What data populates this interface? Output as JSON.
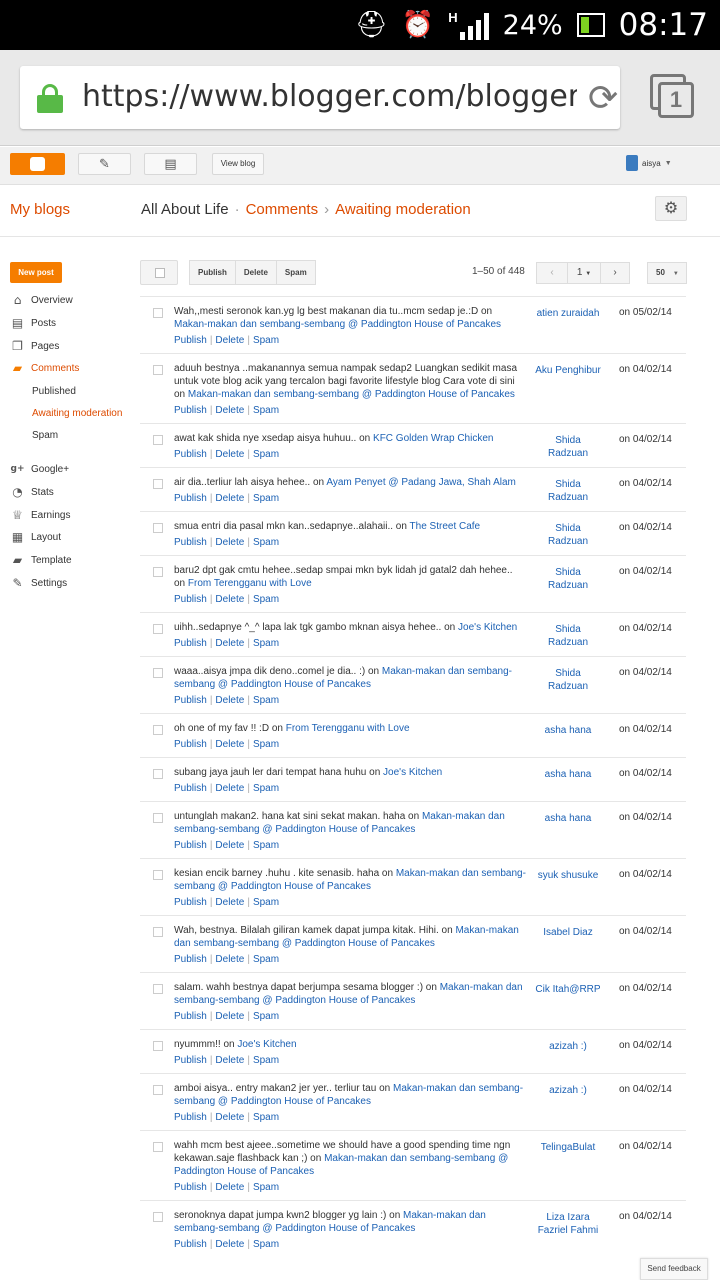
{
  "status_bar": {
    "battery": "24%",
    "time": "08:17",
    "network": "H",
    "icons": [
      "usb-debug-icon",
      "alarm-icon",
      "signal-icon",
      "battery-icon"
    ]
  },
  "browser": {
    "url": "https://www.blogger.com/blogger.g",
    "tab_count": "1"
  },
  "toolbar": {
    "view_blog": "View blog",
    "user": "aisya"
  },
  "header": {
    "my_blogs": "My blogs",
    "blog_name": "All About Life",
    "sep1": "·",
    "comments": "Comments",
    "sep2": "›",
    "current": "Awaiting moderation"
  },
  "sidebar": {
    "new_post": "New post",
    "items": [
      {
        "label": "Overview",
        "icon": "home-icon"
      },
      {
        "label": "Posts",
        "icon": "posts-icon"
      },
      {
        "label": "Pages",
        "icon": "pages-icon"
      },
      {
        "label": "Comments",
        "icon": "comments-icon"
      },
      {
        "label": "Published"
      },
      {
        "label": "Awaiting moderation"
      },
      {
        "label": "Spam"
      },
      {
        "label": "Google+",
        "icon": "google-plus-icon"
      },
      {
        "label": "Stats",
        "icon": "stats-icon"
      },
      {
        "label": "Earnings",
        "icon": "trophy-icon"
      },
      {
        "label": "Layout",
        "icon": "layout-icon"
      },
      {
        "label": "Template",
        "icon": "template-icon"
      },
      {
        "label": "Settings",
        "icon": "wrench-icon"
      }
    ]
  },
  "actions": {
    "publish": "Publish",
    "delete": "Delete",
    "spam": "Spam",
    "range": "1–50 of 448",
    "page": "1",
    "per_page": "50"
  },
  "row_actions": {
    "publish": "Publish",
    "delete": "Delete",
    "spam": "Spam",
    "sep": "|"
  },
  "comments": [
    {
      "text": "Wah,,mesti seronok kan.yg lg best makanan dia tu..mcm sedap je.:D on",
      "post": "Makan-makan dan sembang-sembang @ Paddington House of Pancakes",
      "author": "atien zuraidah",
      "date": "on 05/02/14"
    },
    {
      "text": "aduuh bestnya ..makanannya semua nampak sedap2 Luangkan sedikit masa untuk vote blog acik yang tercalon bagi favorite lifestyle blog Cara vote di sini on",
      "post": "Makan-makan dan sembang-sembang @ Paddington House of Pancakes",
      "author": "Aku Penghibur",
      "date": "on 04/02/14"
    },
    {
      "text": "awat kak shida nye xsedap aisya huhuu.. on",
      "post": "KFC Golden Wrap Chicken",
      "author": "Shida Radzuan",
      "date": "on 04/02/14"
    },
    {
      "text": "air dia..terliur lah aisya hehee.. on",
      "post": "Ayam Penyet @ Padang Jawa, Shah Alam",
      "author": "Shida Radzuan",
      "date": "on 04/02/14"
    },
    {
      "text": "smua entri dia pasal mkn kan..sedapnye..alahaii.. on",
      "post": "The Street Cafe",
      "author": "Shida Radzuan",
      "date": "on 04/02/14"
    },
    {
      "text": "baru2 dpt gak cmtu hehee..sedap smpai mkn byk lidah jd gatal2 dah hehee.. on",
      "post": "From Terengganu with Love",
      "author": "Shida Radzuan",
      "date": "on 04/02/14"
    },
    {
      "text": "uihh..sedapnye ^_^ lapa lak tgk gambo mknan aisya hehee.. on",
      "post": "Joe's Kitchen",
      "author": "Shida Radzuan",
      "date": "on 04/02/14"
    },
    {
      "text": "waaa..aisya jmpa dik deno..comel je dia.. :) on",
      "post": "Makan-makan dan sembang-sembang @ Paddington House of Pancakes",
      "author": "Shida Radzuan",
      "date": "on 04/02/14"
    },
    {
      "text": "oh one of my fav !! :D on",
      "post": "From Terengganu with Love",
      "author": "asha hana",
      "date": "on 04/02/14"
    },
    {
      "text": "subang jaya jauh ler dari tempat hana huhu on",
      "post": "Joe's Kitchen",
      "author": "asha hana",
      "date": "on 04/02/14"
    },
    {
      "text": "untunglah makan2. hana kat sini sekat makan. haha on",
      "post": "Makan-makan dan sembang-sembang @ Paddington House of Pancakes",
      "author": "asha hana",
      "date": "on 04/02/14"
    },
    {
      "text": "kesian encik barney .huhu . kite senasib. haha on",
      "post": "Makan-makan dan sembang-sembang @ Paddington House of Pancakes",
      "author": "syuk shusuke",
      "date": "on 04/02/14"
    },
    {
      "text": "Wah, bestnya. Bilalah giliran kamek dapat jumpa kitak. Hihi. on",
      "post": "Makan-makan dan sembang-sembang @ Paddington House of Pancakes",
      "author": "Isabel Diaz",
      "date": "on 04/02/14"
    },
    {
      "text": "salam. wahh bestnya dapat berjumpa sesama blogger :) on",
      "post": "Makan-makan dan sembang-sembang @ Paddington House of Pancakes",
      "author": "Cik Itah@RRP",
      "date": "on 04/02/14"
    },
    {
      "text": "nyummm!! on",
      "post": "Joe's Kitchen",
      "author": "azizah :)",
      "date": "on 04/02/14"
    },
    {
      "text": "amboi aisya.. entry makan2 jer yer.. terliur tau on",
      "post": "Makan-makan dan sembang-sembang @ Paddington House of Pancakes",
      "author": "azizah :)",
      "date": "on 04/02/14"
    },
    {
      "text": "wahh mcm best ajeee..sometime we should have a good spending time ngn kekawan.saje flashback kan ;) on",
      "post": "Makan-makan dan sembang-sembang @ Paddington House of Pancakes",
      "author": "TelingaBulat",
      "date": "on 04/02/14"
    },
    {
      "text": "seronoknya dapat jumpa kwn2 blogger yg lain :) on",
      "post": "Makan-makan dan sembang-sembang @ Paddington House of Pancakes",
      "author": "Liza Izara Fazriel Fahmi",
      "date": "on 04/02/14"
    }
  ],
  "footer": {
    "feedback": "Send feedback"
  },
  "colors": {
    "accent": "#f57d00",
    "link": "#1c61b4",
    "breadcrumb": "#dd4b00"
  }
}
